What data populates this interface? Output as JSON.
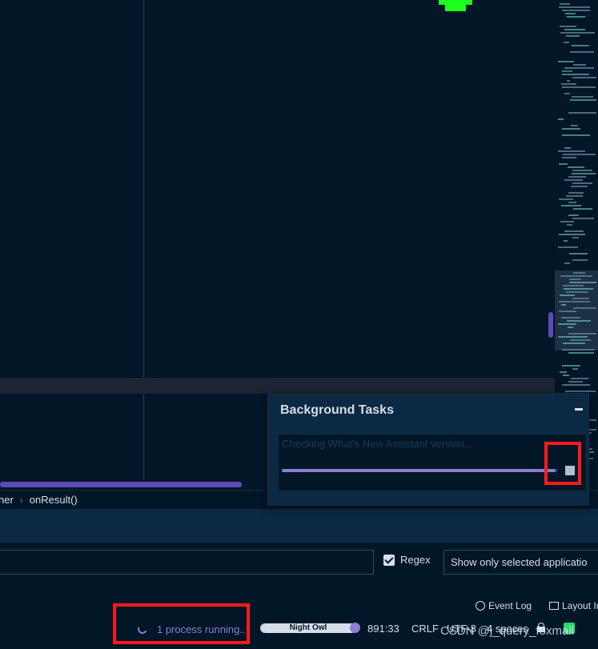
{
  "background_tasks": {
    "title": "Background Tasks",
    "task_name": "Checking What's New Assistant version...",
    "progress": 0.99
  },
  "breadcrumb": {
    "segment_1": "ner",
    "segment_2": "onResult()"
  },
  "filter": {
    "regex_label": "Regex",
    "regex_checked": true,
    "show_only_label": "Show only selected applicatio"
  },
  "tool_links": {
    "event_log": "Event Log",
    "layout": "Layout In"
  },
  "status_bar": {
    "process_running": "1 process running...",
    "theme_name": "Night Owl",
    "cursor_position": "891:33",
    "line_separator": "CRLF",
    "encoding": "UTF-8",
    "indent": "4 spaces"
  },
  "watermark": "CSDN @j_query_foxmail",
  "colors": {
    "background": "#011627",
    "panel": "#0b2942",
    "accent": "#8f7dd0",
    "highlight_box": "#ff1a1a",
    "marker_green": "#1eff1e"
  },
  "icons": {
    "minimize": "minimize-icon",
    "stop": "stop-icon",
    "spinner": "spinner-icon",
    "event_log": "event-log-icon",
    "layout": "layout-icon",
    "lock": "lock-icon"
  }
}
